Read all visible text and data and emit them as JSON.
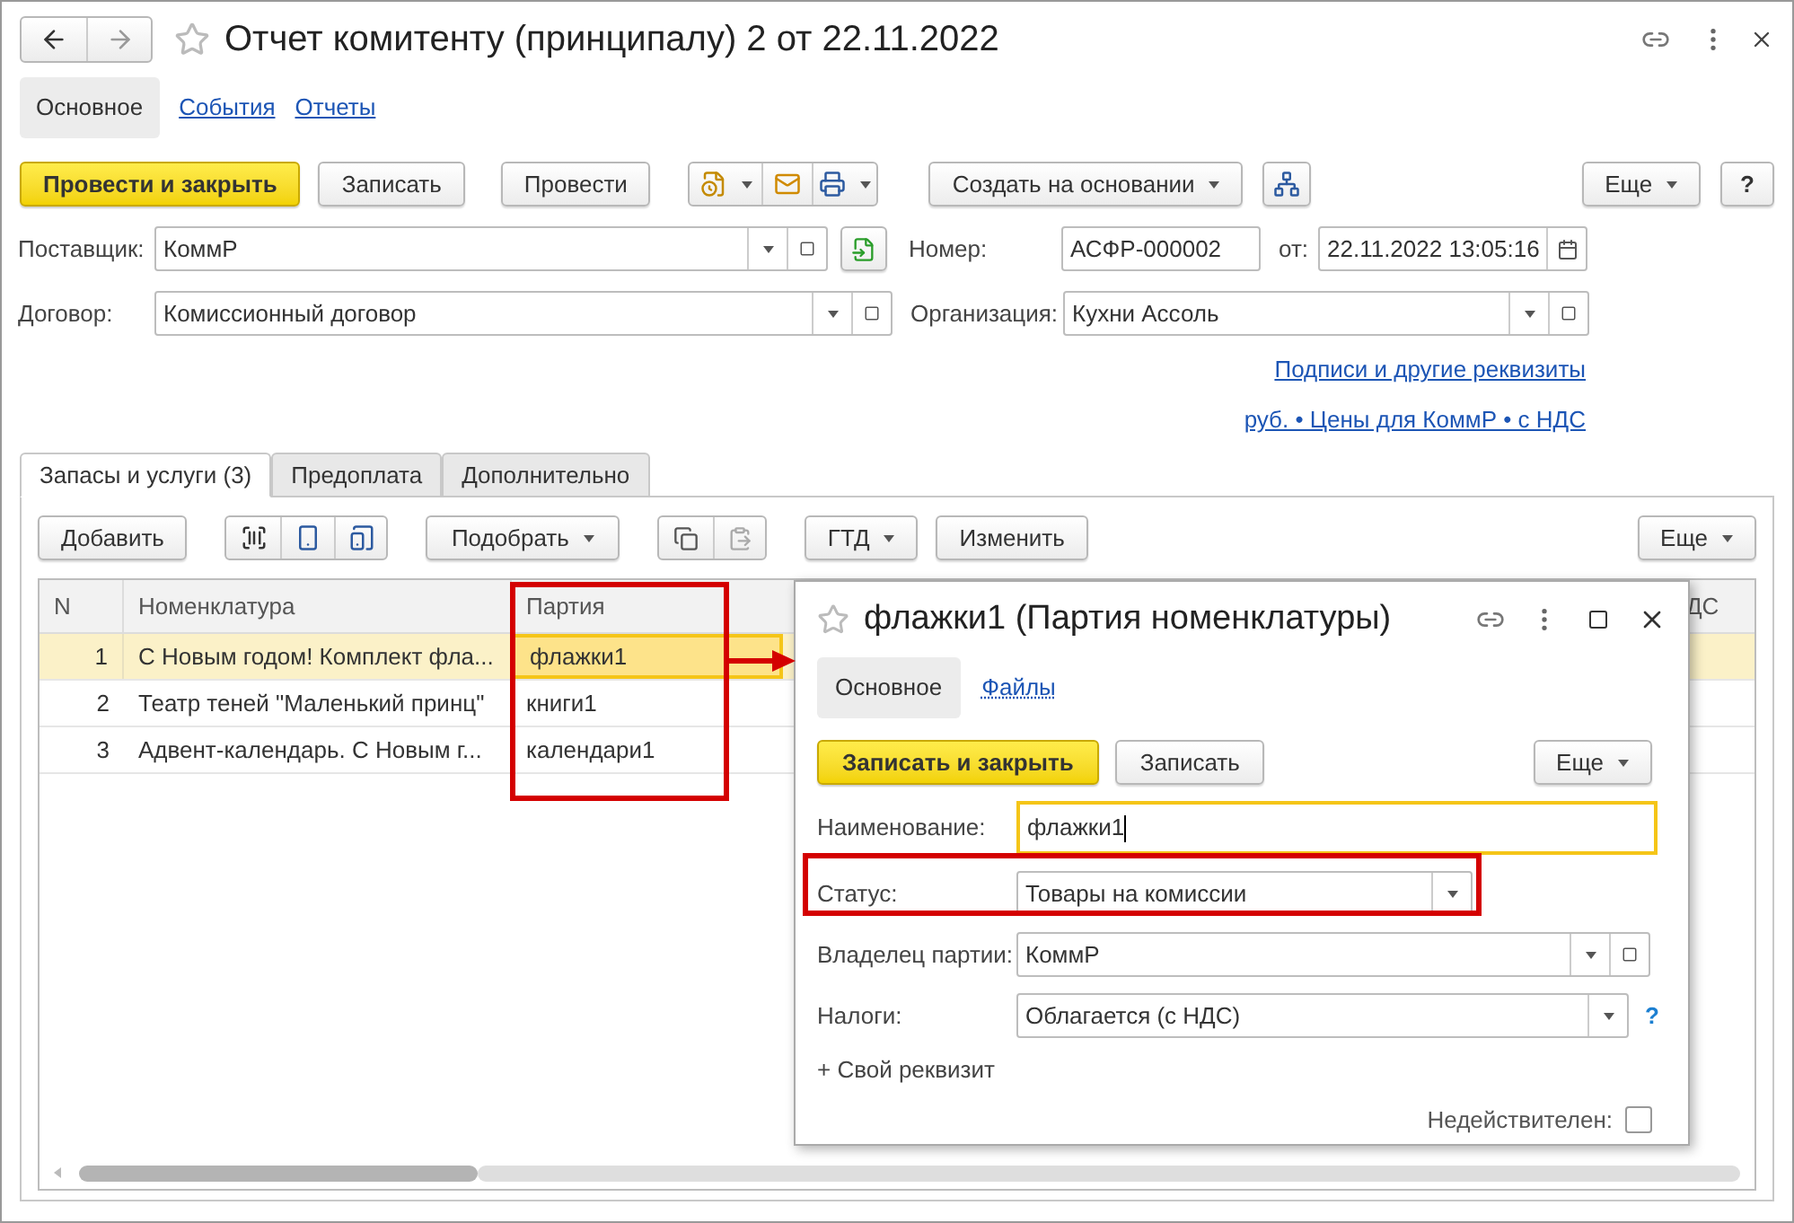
{
  "window": {
    "title": "Отчет комитенту (принципалу) 2 от 22.11.2022",
    "tabs": [
      {
        "label": "Основное",
        "selected": true
      },
      {
        "label": "События",
        "selected": false
      },
      {
        "label": "Отчеты",
        "selected": false
      }
    ]
  },
  "toolbar": [
    {
      "kind": "primary",
      "label": "Провести и закрыть"
    },
    {
      "kind": "plain",
      "label": "Записать"
    },
    {
      "kind": "plain",
      "label": "Провести"
    },
    {
      "kind": "icon-group"
    },
    {
      "kind": "menu",
      "label": "Создать на основании"
    },
    {
      "kind": "icon"
    },
    {
      "kind": "menu-right",
      "label": "Еще"
    },
    {
      "kind": "help",
      "label": "?"
    }
  ],
  "fields": {
    "supplier": {
      "label": "Поставщик:",
      "value": "КоммР"
    },
    "number": {
      "label": "Номер:",
      "value": "АСФР-000002"
    },
    "date": {
      "label": "от:",
      "value": "22.11.2022 13:05:16"
    },
    "contract": {
      "label": "Договор:",
      "value": "Комиссионный договор"
    },
    "organization": {
      "label": "Организация:",
      "value": "Кухни Ассоль"
    }
  },
  "links": [
    "Подписи и другие реквизиты",
    "руб. • Цены для КоммР • с НДС"
  ],
  "doc_tabs": [
    {
      "label": "Запасы и услуги (3)",
      "selected": true
    },
    {
      "label": "Предоплата",
      "selected": false
    },
    {
      "label": "Дополнительно",
      "selected": false
    }
  ],
  "table_toolbar": {
    "add": "Добавить",
    "pick": "Подобрать",
    "gtd": "ГТД",
    "edit": "Изменить",
    "more": "Еще"
  },
  "table": {
    "columns": [
      "N",
      "Номенклатура",
      "Партия",
      "ДС"
    ],
    "rows": [
      {
        "n": "1",
        "name": "С Новым годом! Комплект фла...",
        "batch": "флажки1",
        "selected": true
      },
      {
        "n": "2",
        "name": "Театр теней \"Маленький принц\"",
        "batch": "книги1",
        "selected": false
      },
      {
        "n": "3",
        "name": "Адвент-календарь. С Новым г...",
        "batch": "календари1",
        "selected": false
      }
    ]
  },
  "dialog": {
    "title": "флажки1 (Партия номенклатуры)",
    "tabs": [
      {
        "label": "Основное",
        "selected": true
      },
      {
        "label": "Файлы",
        "selected": false
      }
    ],
    "buttons": {
      "primary": "Записать и закрыть",
      "save": "Записать",
      "more": "Еще"
    },
    "fields": [
      {
        "kind": "text",
        "label": "Наименование:",
        "value": "флажки1",
        "focused": true
      },
      {
        "kind": "select",
        "label": "Статус:",
        "value": "Товары на комиссии"
      },
      {
        "kind": "select-open",
        "label": "Владелец партии:",
        "value": "КоммР"
      },
      {
        "kind": "select-help",
        "label": "Налоги:",
        "value": "Облагается (с НДС)",
        "help": "?"
      }
    ],
    "add_link": "+ Свой реквизит",
    "checkbox": {
      "label": "Недействителен:",
      "checked": false
    }
  }
}
